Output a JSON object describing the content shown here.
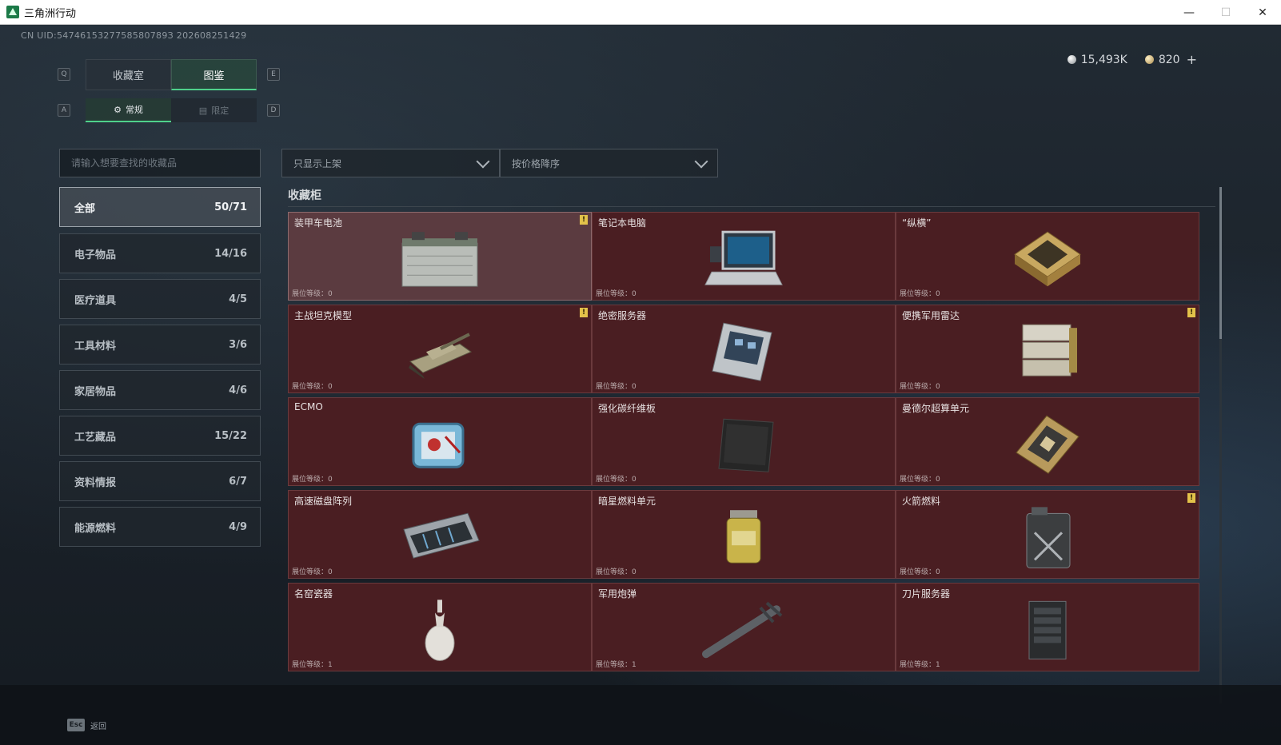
{
  "window": {
    "title": "三角洲行动"
  },
  "uid": "CN UID:5474615327758580789З 202608251429",
  "currency": {
    "silver": "15,493K",
    "gold": "820"
  },
  "keys": {
    "q": "Q",
    "e": "E",
    "a": "A",
    "d": "D",
    "esc": "Esc"
  },
  "main_tabs": [
    {
      "label": "收藏室"
    },
    {
      "label": "图鉴"
    }
  ],
  "sub_tabs": [
    {
      "label": "常规"
    },
    {
      "label": "限定"
    }
  ],
  "search": {
    "placeholder": "请输入想要查找的收藏品"
  },
  "filters": {
    "shelf": "只显示上架",
    "sort": "按价格降序"
  },
  "categories": [
    {
      "label": "全部",
      "count": "50/71"
    },
    {
      "label": "电子物品",
      "count": "14/16"
    },
    {
      "label": "医疗道具",
      "count": "4/5"
    },
    {
      "label": "工具材料",
      "count": "3/6"
    },
    {
      "label": "家居物品",
      "count": "4/6"
    },
    {
      "label": "工艺藏品",
      "count": "15/22"
    },
    {
      "label": "资料情报",
      "count": "6/7"
    },
    {
      "label": "能源燃料",
      "count": "4/9"
    }
  ],
  "section": {
    "title": "收藏柜"
  },
  "alert_symbol": "!",
  "items": [
    {
      "name": "装甲车电池",
      "level": "展位等级：0",
      "alert": true,
      "icon": "battery-icon"
    },
    {
      "name": "笔记本电脑",
      "level": "展位等级：0",
      "alert": false,
      "icon": "laptop-icon"
    },
    {
      "name": "“纵横”",
      "level": "展位等级：0",
      "alert": false,
      "icon": "chess-board-icon"
    },
    {
      "name": "主战坦克模型",
      "level": "展位等级：0",
      "alert": true,
      "icon": "tank-icon"
    },
    {
      "name": "绝密服务器",
      "level": "展位等级：0",
      "alert": false,
      "icon": "server-icon"
    },
    {
      "name": "便携军用雷达",
      "level": "展位等级：0",
      "alert": true,
      "icon": "radar-icon"
    },
    {
      "name": "ECMO",
      "level": "展位等级：0",
      "alert": false,
      "icon": "ecmo-icon"
    },
    {
      "name": "强化碳纤维板",
      "level": "展位等级：0",
      "alert": false,
      "icon": "carbon-plate-icon"
    },
    {
      "name": "曼德尔超算单元",
      "level": "展位等级：0",
      "alert": false,
      "icon": "gpu-icon"
    },
    {
      "name": "高速磁盘阵列",
      "level": "展位等级：0",
      "alert": false,
      "icon": "disk-array-icon"
    },
    {
      "name": "暗星燃料单元",
      "level": "展位等级：0",
      "alert": false,
      "icon": "fuel-cell-icon"
    },
    {
      "name": "火箭燃料",
      "level": "展位等级：0",
      "alert": true,
      "icon": "fuel-can-icon"
    },
    {
      "name": "名窑瓷器",
      "level": "展位等级：1",
      "alert": false,
      "icon": "vase-icon"
    },
    {
      "name": "军用炮弹",
      "level": "展位等级：1",
      "alert": false,
      "icon": "shell-icon"
    },
    {
      "name": "刀片服务器",
      "level": "展位等级：1",
      "alert": false,
      "icon": "blade-server-icon"
    }
  ],
  "footer": {
    "back": "返回"
  }
}
